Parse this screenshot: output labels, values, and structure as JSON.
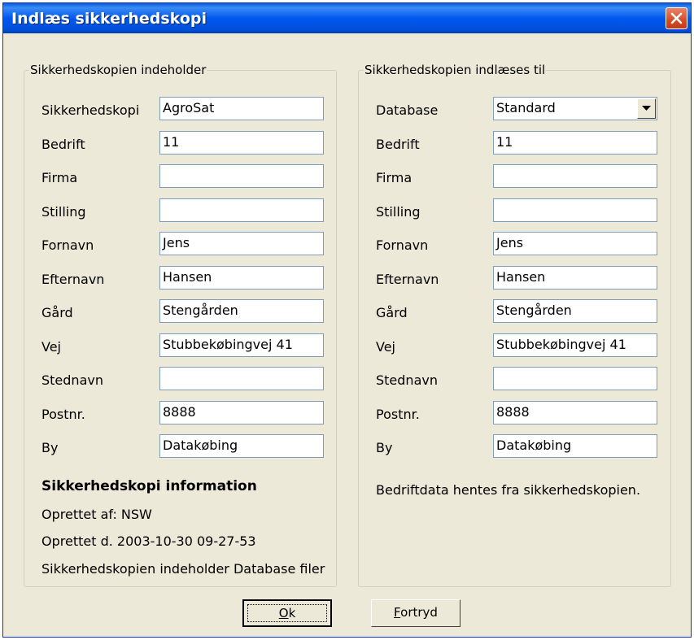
{
  "window": {
    "title": "Indlæs sikkerhedskopi"
  },
  "left": {
    "legend": "Sikkerhedskopien indeholder",
    "fields": [
      {
        "label": "Sikkerhedskopi",
        "value": "AgroSat"
      },
      {
        "label": "Bedrift",
        "value": "11"
      },
      {
        "label": "Firma",
        "value": ""
      },
      {
        "label": "Stilling",
        "value": ""
      },
      {
        "label": "Fornavn",
        "value": "Jens"
      },
      {
        "label": "Efternavn",
        "value": "Hansen"
      },
      {
        "label": "Gård",
        "value": "Stengården"
      },
      {
        "label": "Vej",
        "value": "Stubbekøbingvej 41"
      },
      {
        "label": "Stednavn",
        "value": ""
      },
      {
        "label": "Postnr.",
        "value": "8888"
      },
      {
        "label": "By",
        "value": "Datakøbing"
      }
    ],
    "info_heading": "Sikkerhedskopi information",
    "info_lines": [
      "Oprettet af: NSW",
      "Oprettet d. 2003-10-30 09-27-53",
      "Sikkerhedskopien indeholder Database filer"
    ]
  },
  "right": {
    "legend": "Sikkerhedskopien indlæses til",
    "database": {
      "label": "Database",
      "value": "Standard"
    },
    "fields": [
      {
        "label": "Bedrift",
        "value": "11"
      },
      {
        "label": "Firma",
        "value": ""
      },
      {
        "label": "Stilling",
        "value": ""
      },
      {
        "label": "Fornavn",
        "value": "Jens"
      },
      {
        "label": "Efternavn",
        "value": "Hansen"
      },
      {
        "label": "Gård",
        "value": "Stengården"
      },
      {
        "label": "Vej",
        "value": "Stubbekøbingvej 41"
      },
      {
        "label": "Stednavn",
        "value": ""
      },
      {
        "label": "Postnr.",
        "value": "8888"
      },
      {
        "label": "By",
        "value": "Datakøbing"
      }
    ],
    "note": "Bedriftdata hentes fra sikkerhedskopien."
  },
  "buttons": {
    "ok_hotkey": "O",
    "ok_rest": "k",
    "cancel_hotkey": "F",
    "cancel_rest": "ortryd"
  }
}
